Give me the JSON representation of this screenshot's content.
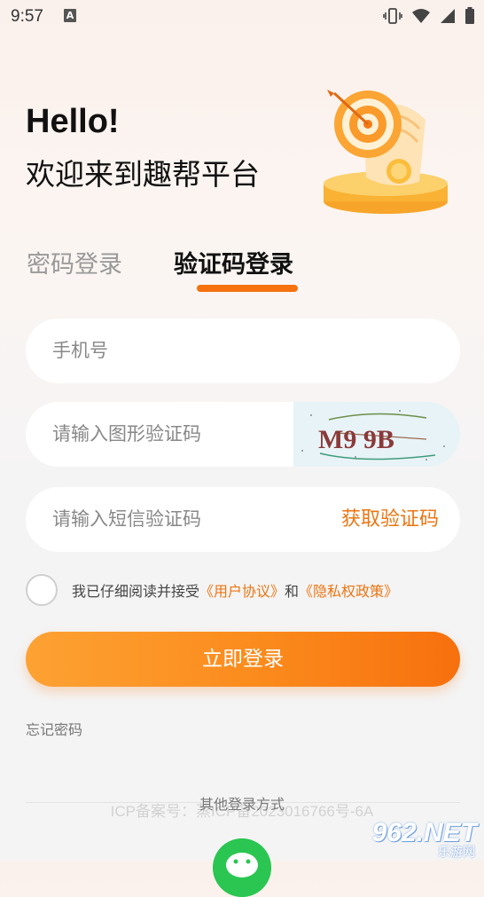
{
  "status_bar": {
    "time": "9:57",
    "notification_icon": "A",
    "icons": [
      "vibrate-icon",
      "wifi-icon",
      "signal-icon",
      "battery-icon"
    ]
  },
  "header": {
    "hello": "Hello!",
    "welcome": "欢迎来到趣帮平台"
  },
  "tabs": {
    "password": "密码登录",
    "sms": "验证码登录",
    "active": "sms"
  },
  "form": {
    "phone_placeholder": "手机号",
    "captcha_placeholder": "请输入图形验证码",
    "captcha_text": "M9 9B",
    "sms_placeholder": "请输入短信验证码",
    "get_code": "获取验证码"
  },
  "agreement": {
    "prefix": "我已仔细阅读并接受",
    "user_agreement": "《用户协议》",
    "and": "和",
    "privacy_policy": "《隐私权政策》",
    "checked": false
  },
  "login_button": "立即登录",
  "forgot_password": "忘记密码",
  "other_login": "其他登录方式",
  "icp": "ICP备案号：蒸ICP备2023016766号-6A",
  "watermark": {
    "main": "962.NET",
    "sub": "乐游网"
  },
  "colors": {
    "accent": "#f5720f",
    "link": "#ec7512",
    "wechat": "#2ac651"
  }
}
